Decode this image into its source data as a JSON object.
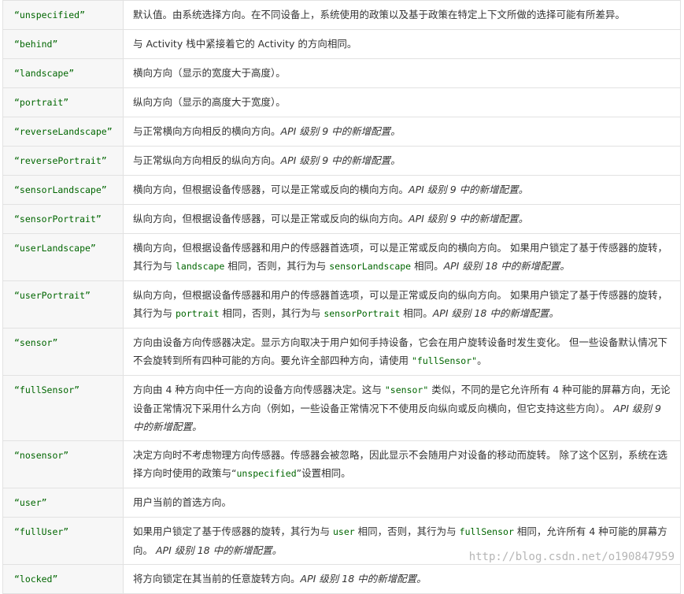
{
  "rows": [
    {
      "key": "“unspecified”",
      "parts": [
        {
          "t": "默认值。由系统选择方向。在不同设备上，系统使用的政策以及基于政策在特定上下文所做的选择可能有所差异。"
        }
      ]
    },
    {
      "key": "“behind”",
      "parts": [
        {
          "t": "与 Activity 栈中紧接着它的 Activity 的方向相同。"
        }
      ]
    },
    {
      "key": "“landscape”",
      "parts": [
        {
          "t": "横向方向（显示的宽度大于高度）。"
        }
      ]
    },
    {
      "key": "“portrait”",
      "parts": [
        {
          "t": "纵向方向（显示的高度大于宽度）。"
        }
      ]
    },
    {
      "key": "“reverseLandscape”",
      "parts": [
        {
          "t": "与正常横向方向相反的横向方向。"
        },
        {
          "t": "API 级别 9 中的新增配置。",
          "s": "note"
        }
      ]
    },
    {
      "key": "“reversePortrait”",
      "parts": [
        {
          "t": "与正常纵向方向相反的纵向方向。"
        },
        {
          "t": "API 级别 9 中的新增配置。",
          "s": "note"
        }
      ]
    },
    {
      "key": "“sensorLandscape”",
      "parts": [
        {
          "t": "横向方向，但根据设备传感器，可以是正常或反向的横向方向。"
        },
        {
          "t": "API 级别 9 中的新增配置。",
          "s": "note"
        }
      ]
    },
    {
      "key": "“sensorPortrait”",
      "parts": [
        {
          "t": "纵向方向，但根据设备传感器，可以是正常或反向的纵向方向。"
        },
        {
          "t": "API 级别 9 中的新增配置。",
          "s": "note"
        }
      ]
    },
    {
      "key": "“userLandscape”",
      "parts": [
        {
          "t": "横向方向，但根据设备传感器和用户的传感器首选项，可以是正常或反向的横向方向。 如果用户锁定了基于传感器的旋转，其行为与 "
        },
        {
          "t": "landscape",
          "s": "code"
        },
        {
          "t": " 相同，否则，其行为与 "
        },
        {
          "t": "sensorLandscape",
          "s": "code"
        },
        {
          "t": " 相同。"
        },
        {
          "t": "API 级别 18 中的新增配置。",
          "s": "note"
        }
      ]
    },
    {
      "key": "“userPortrait”",
      "parts": [
        {
          "t": "纵向方向，但根据设备传感器和用户的传感器首选项，可以是正常或反向的纵向方向。 如果用户锁定了基于传感器的旋转，其行为与 "
        },
        {
          "t": "portrait",
          "s": "code"
        },
        {
          "t": " 相同，否则，其行为与 "
        },
        {
          "t": "sensorPortrait",
          "s": "code"
        },
        {
          "t": " 相同。"
        },
        {
          "t": "API 级别 18 中的新增配置。",
          "s": "note"
        }
      ]
    },
    {
      "key": "“sensor”",
      "parts": [
        {
          "t": "方向由设备方向传感器决定。显示方向取决于用户如何手持设备，它会在用户旋转设备时发生变化。 但一些设备默认情况下不会旋转到所有四种可能的方向。要允许全部四种方向，请使用 "
        },
        {
          "t": "\"fullSensor\"",
          "s": "code"
        },
        {
          "t": "。"
        }
      ]
    },
    {
      "key": "“fullSensor”",
      "parts": [
        {
          "t": "方向由 4 种方向中任一方向的设备方向传感器决定。这与 "
        },
        {
          "t": "\"sensor\"",
          "s": "code"
        },
        {
          "t": " 类似，不同的是它允许所有 4 种可能的屏幕方向，无论设备正常情况下采用什么方向（例如，一些设备正常情况下不使用反向纵向或反向横向，但它支持这些方向）。 "
        },
        {
          "t": "API 级别 9 中的新增配置。",
          "s": "note"
        }
      ]
    },
    {
      "key": "“nosensor”",
      "parts": [
        {
          "t": "决定方向时不考虑物理方向传感器。传感器会被忽略，因此显示不会随用户对设备的移动而旋转。 除了这个区别，系统在选择方向时使用的政策与“"
        },
        {
          "t": "unspecified",
          "s": "code"
        },
        {
          "t": "”设置相同。"
        }
      ]
    },
    {
      "key": "“user”",
      "parts": [
        {
          "t": "用户当前的首选方向。"
        }
      ]
    },
    {
      "key": "“fullUser”",
      "parts": [
        {
          "t": "如果用户锁定了基于传感器的旋转，其行为与 "
        },
        {
          "t": "user",
          "s": "code"
        },
        {
          "t": " 相同，否则，其行为与 "
        },
        {
          "t": "fullSensor",
          "s": "code"
        },
        {
          "t": " 相同，允许所有 4 种可能的屏幕方向。 "
        },
        {
          "t": "API 级别 18 中的新增配置。",
          "s": "note"
        }
      ]
    },
    {
      "key": "“locked”",
      "parts": [
        {
          "t": "将方向锁定在其当前的任意旋转方向。"
        },
        {
          "t": "API 级别 18 中的新增配置。",
          "s": "note"
        }
      ]
    }
  ],
  "watermark": "http://blog.csdn.net/o190847959"
}
